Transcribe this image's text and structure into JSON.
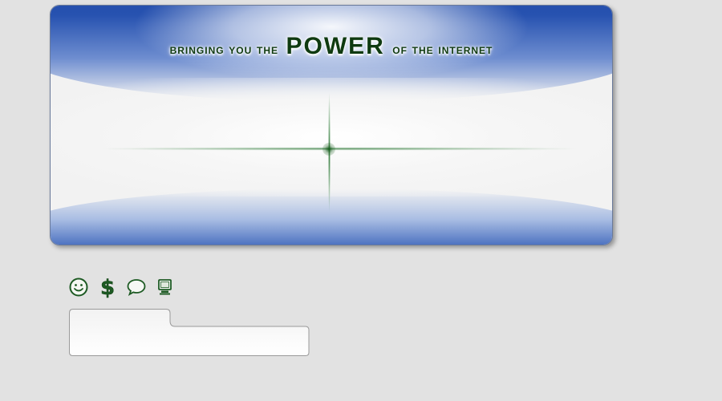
{
  "banner": {
    "tagline_pre": "Bringing you the",
    "tagline_highlight": "POWER",
    "tagline_post": "of the internet"
  },
  "icons": [
    {
      "name": "smiley-icon"
    },
    {
      "name": "dollar-icon"
    },
    {
      "name": "speech-bubble-icon"
    },
    {
      "name": "computer-icon"
    }
  ],
  "colors": {
    "background": "#e2e2e2",
    "banner_blue": "#2752b0",
    "accent_green": "#1d5a23"
  }
}
